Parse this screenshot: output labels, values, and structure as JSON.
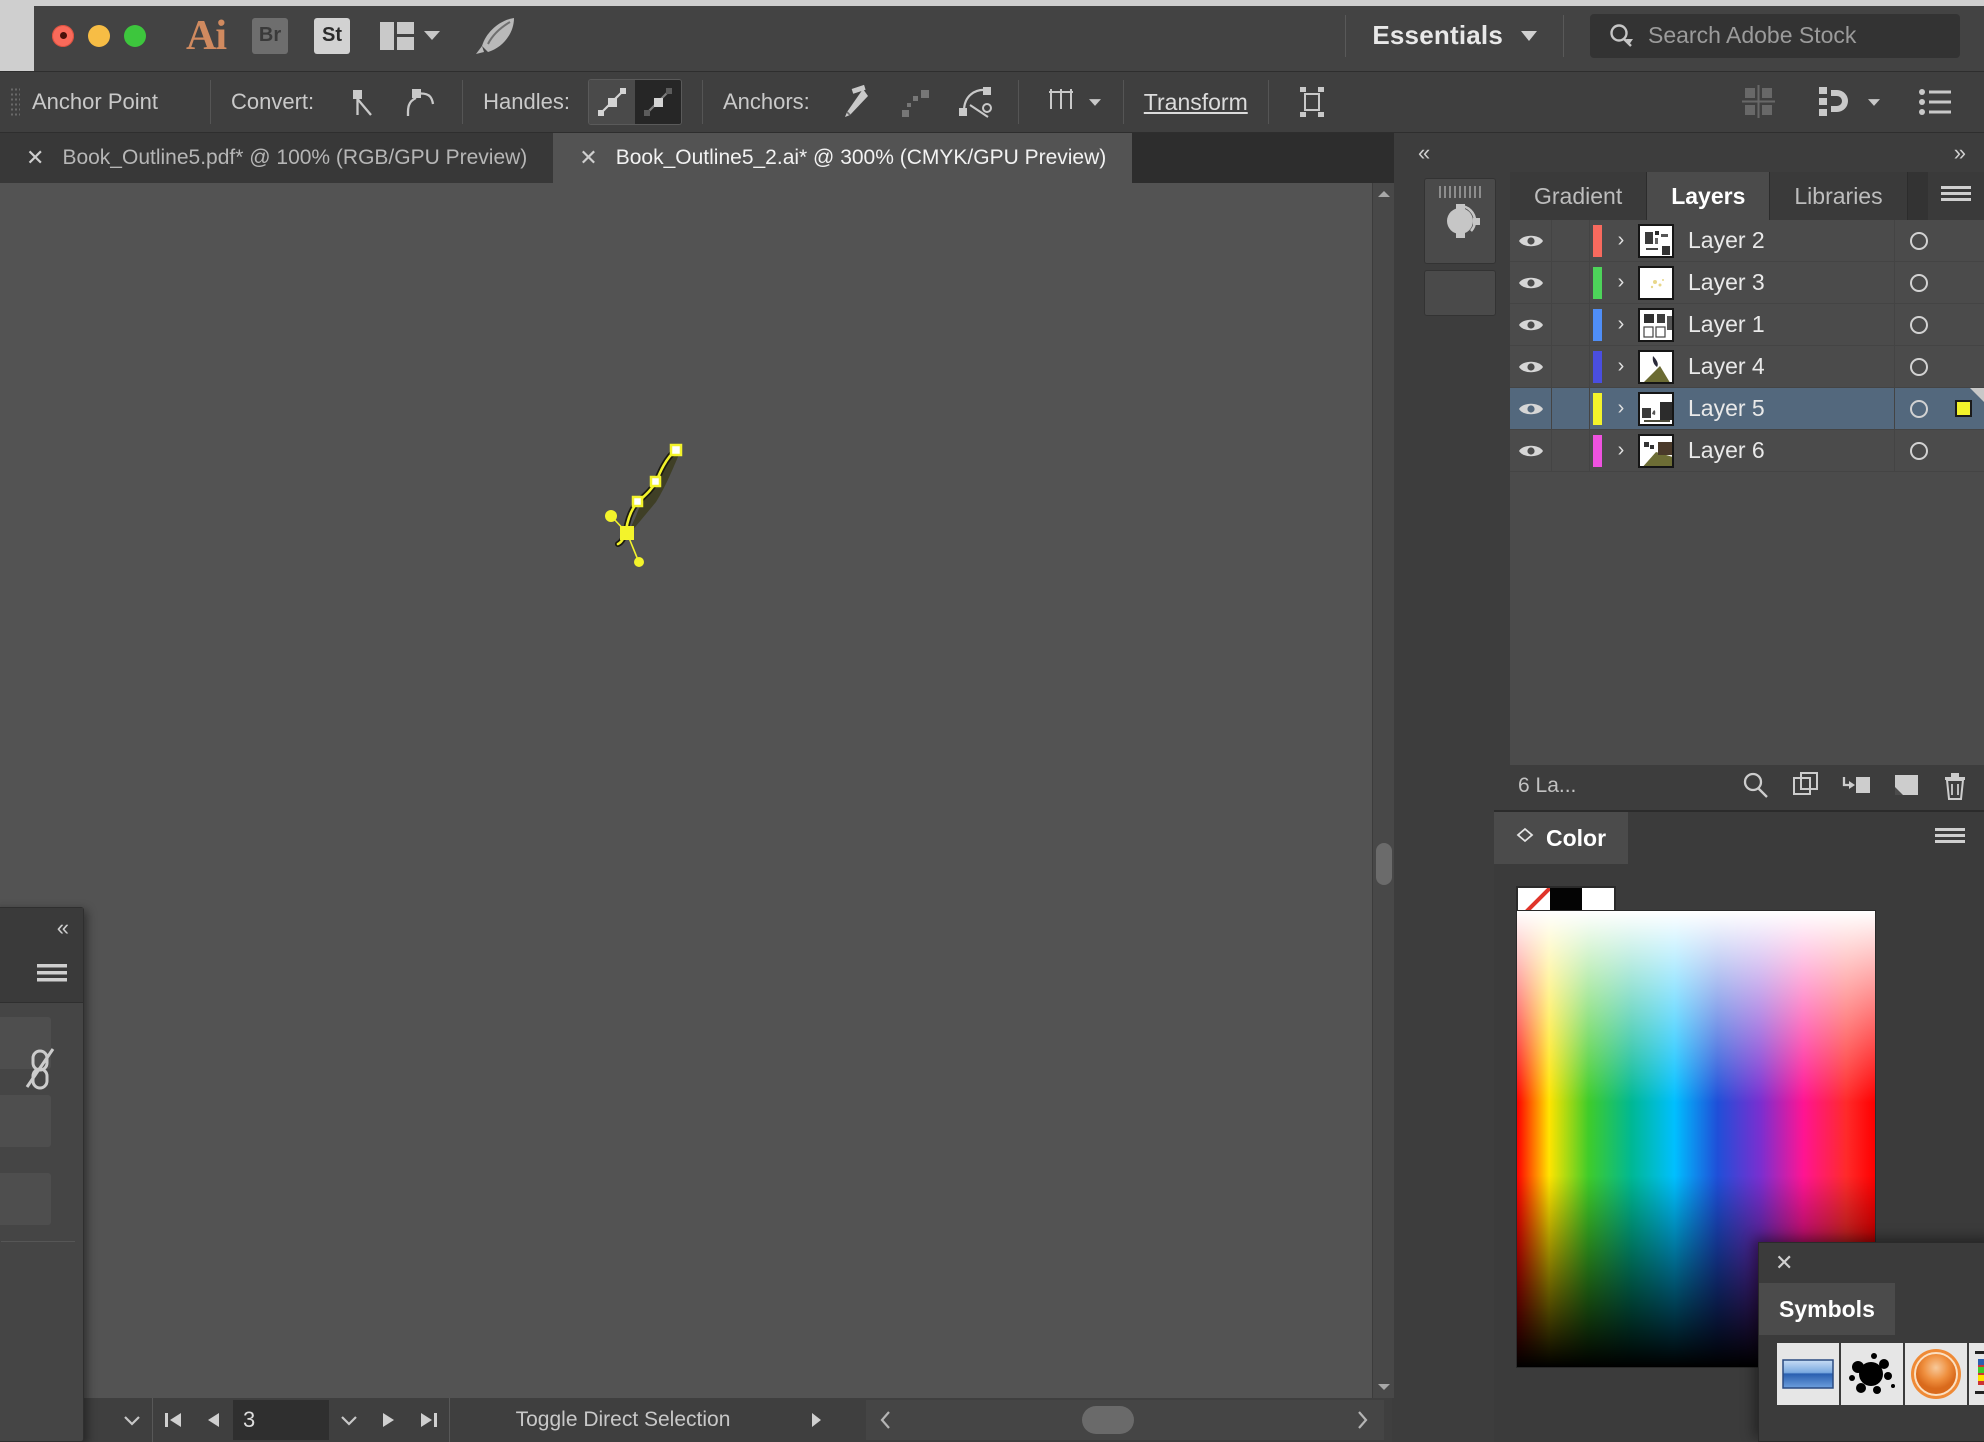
{
  "app": {
    "name": "Adobe Illustrator",
    "logo_text": "Ai",
    "bridge_label": "Br",
    "stock_label": "St",
    "workspace": "Essentials",
    "search_placeholder": "Search Adobe Stock"
  },
  "optionsbar": {
    "tool_label": "Anchor Point",
    "convert_label": "Convert:",
    "handles_label": "Handles:",
    "anchors_label": "Anchors:",
    "transform_label": "Transform"
  },
  "tabs": [
    {
      "title": "Book_Outline5.pdf* @ 100% (RGB/GPU Preview)",
      "active": false
    },
    {
      "title": "Book_Outline5_2.ai* @ 300% (CMYK/GPU Preview)",
      "active": true
    }
  ],
  "statusbar": {
    "page_value": "3",
    "status_text": "Toggle Direct Selection"
  },
  "panels": {
    "tabs": [
      {
        "label": "Gradient",
        "active": false
      },
      {
        "label": "Layers",
        "active": true
      },
      {
        "label": "Libraries",
        "active": false
      }
    ],
    "layers": [
      {
        "name": "Layer 2",
        "color": "#f86a5e",
        "visible": true,
        "selected": false,
        "thumb": "text-page"
      },
      {
        "name": "Layer 3",
        "color": "#4dd45a",
        "visible": true,
        "selected": false,
        "thumb": "sparse"
      },
      {
        "name": "Layer 1",
        "color": "#4f8ef7",
        "visible": true,
        "selected": false,
        "thumb": "grid-page"
      },
      {
        "name": "Layer 4",
        "color": "#4a4ee0",
        "visible": true,
        "selected": false,
        "thumb": "leaf"
      },
      {
        "name": "Layer 5",
        "color": "#f3f32b",
        "visible": true,
        "selected": true,
        "thumb": "scene"
      },
      {
        "name": "Layer 6",
        "color": "#ef52e0",
        "visible": true,
        "selected": false,
        "thumb": "hill"
      }
    ],
    "layers_footer_count": "6 La...",
    "color": {
      "title": "Color",
      "swatches": [
        {
          "name": "none",
          "hex": "#ffffff"
        },
        {
          "name": "black",
          "hex": "#040404"
        },
        {
          "name": "white",
          "hex": "#ffffff"
        }
      ]
    },
    "symbols": {
      "title": "Symbols",
      "items": [
        "blue-rectangle-symbol",
        "ink-splat-symbol",
        "orange-circle-symbol"
      ]
    }
  },
  "icons": {
    "search": "search-icon",
    "rocket": "rocket-icon",
    "arrange": "arrange-documents-icon",
    "eye": "eye-icon",
    "trash": "trash-icon",
    "magnify": "locate-object-icon"
  },
  "colors": {
    "accent_selected_row": "#53687d",
    "canvas": "#535353",
    "panel_bg": "#3d3d3d",
    "selection_yellow": "#f3f32b"
  }
}
